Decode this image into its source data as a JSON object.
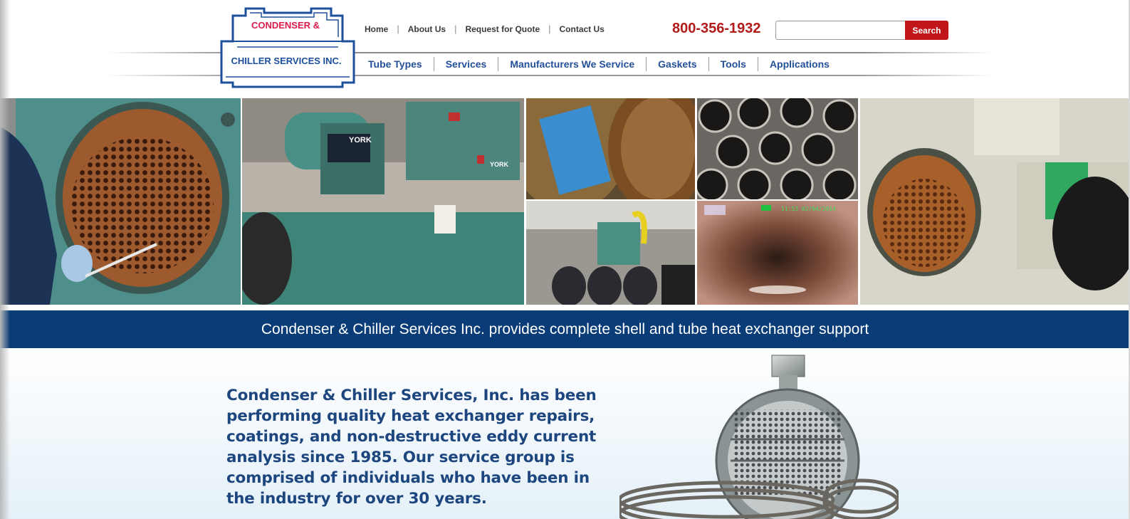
{
  "header": {
    "logo": {
      "line1": "CONDENSER &",
      "line2": "CHILLER SERVICES INC."
    },
    "top_nav": [
      "Home",
      "About Us",
      "Request for Quote",
      "Contact Us"
    ],
    "phone": "800-356-1932",
    "search": {
      "placeholder": "",
      "button_label": "Search"
    },
    "main_nav": [
      "Tube Types",
      "Services",
      "Manufacturers We Service",
      "Gaskets",
      "Tools",
      "Applications"
    ]
  },
  "hero": {
    "equipment_label_1": "YORK",
    "equipment_label_2": "YORK",
    "camera_timestamp": "11:53 02/04/2014"
  },
  "banner": {
    "text": "Condenser & Chiller Services Inc. provides complete shell and tube heat exchanger support"
  },
  "content": {
    "intro": "Condenser & Chiller Services, Inc. has been performing quality heat exchanger repairs, coatings, and non-destructive eddy current analysis since 1985. Our service group is comprised of individuals who have been in the industry for over 30 years."
  },
  "colors": {
    "brand_blue": "#0a3d78",
    "brand_red": "#c0151b",
    "nav_blue": "#23509a",
    "phone_red": "#b31b1b"
  }
}
